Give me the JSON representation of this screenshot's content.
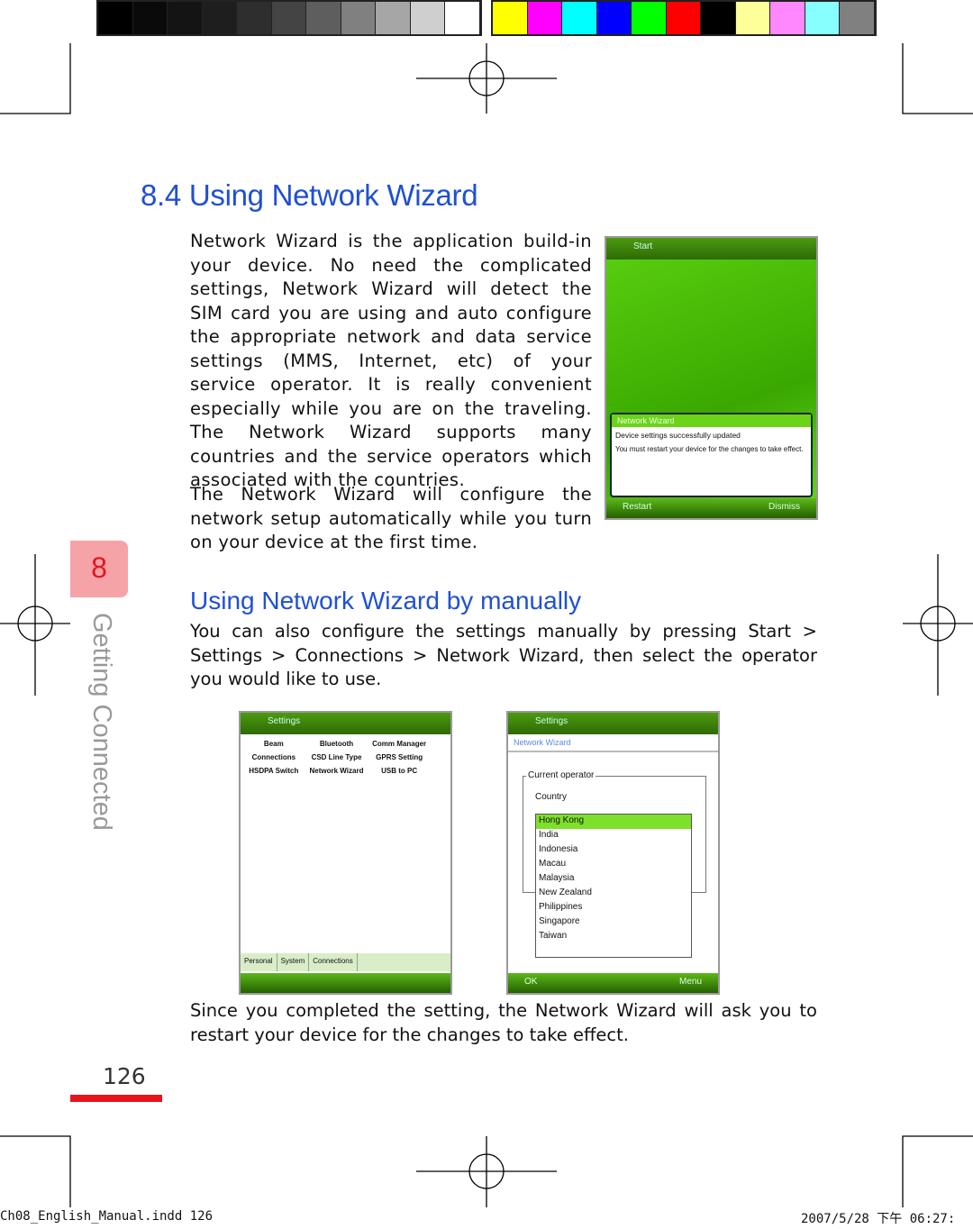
{
  "color_bar": {
    "grays": [
      "#000000",
      "#0a0a0a",
      "#141414",
      "#1e1e1e",
      "#2e2e2e",
      "#444444",
      "#5e5e5e",
      "#808080",
      "#a6a6a6",
      "#cfcfcf",
      "#ffffff"
    ],
    "colors": [
      "#ffff00",
      "#ff00ff",
      "#00ffff",
      "#0000ff",
      "#00ff00",
      "#ff0000",
      "#000000",
      "#ffff99",
      "#ff88ff",
      "#88ffff",
      "#808080"
    ]
  },
  "heading": "8.4 Using Network Wizard",
  "para1": "Network Wizard is the application build-in your device. No need the complicated settings, Network Wizard will detect the SIM card you are using and auto configure the appropriate network and data service settings (MMS, Internet, etc) of your service operator. It is really convenient especially while you are on the traveling. The Network Wizard supports many countries and the service operators which associated with the countries.",
  "para2": "The Network Wizard will configure the network setup automatically while you turn on your device at the first time.",
  "subheading": "Using Network Wizard by manually",
  "para3": "You can also configure the settings manually by pressing Start > Settings > Connections > Network Wizard, then select the operator you would like to use.",
  "para4": "Since you completed the setting, the Network Wizard will ask you to restart your device for the changes to take effect.",
  "shot1": {
    "title": "Start",
    "dialog_title": "Network Wizard",
    "msg1": "Device settings successfully updated",
    "msg2": "You must restart your device for the changes to take effect.",
    "left": "Restart",
    "right": "Dismiss"
  },
  "shot2": {
    "title": "Settings",
    "items": [
      "Beam",
      "Bluetooth",
      "Comm Manager",
      "Connections",
      "CSD Line Type",
      "GPRS Setting",
      "HSDPA Switch",
      "Network Wizard",
      "USB to PC"
    ],
    "tabs": [
      "Personal",
      "System",
      "Connections"
    ]
  },
  "shot3": {
    "title": "Settings",
    "header": "Network Wizard",
    "group": "Current operator",
    "label": "Country",
    "selected": "Hong Kong",
    "options": [
      "Hong Kong",
      "India",
      "Indonesia",
      "Macau",
      "Malaysia",
      "New Zealand",
      "Philippines",
      "Singapore",
      "Taiwan"
    ],
    "left": "OK",
    "right": "Menu"
  },
  "chapter": {
    "number": "8",
    "title": "Getting Connected"
  },
  "page_number": "126",
  "footer": {
    "file": "Ch08_English_Manual.indd   126",
    "date": "2007/5/28   下午 06:27:"
  },
  "accent": "#1f4fd6",
  "tab_color": "#f6a3a8",
  "rule_color": "#e8141c"
}
